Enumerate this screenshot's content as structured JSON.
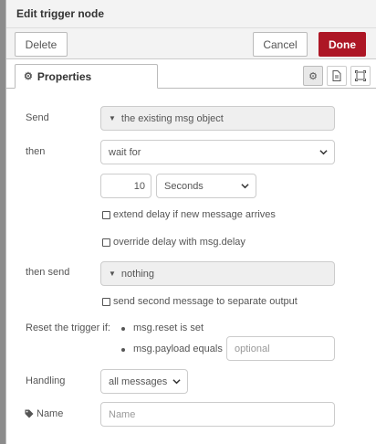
{
  "dialog": {
    "title": "Edit trigger node"
  },
  "tray": {
    "delete_label": "Delete",
    "cancel_label": "Cancel",
    "done_label": "Done"
  },
  "tabs": {
    "properties_label": "Properties"
  },
  "form": {
    "send": {
      "label": "Send",
      "value": "the existing msg object"
    },
    "then": {
      "label": "then",
      "value": "wait for"
    },
    "delay": {
      "value": "10",
      "unit": "Seconds"
    },
    "extend_delay": {
      "label": "extend delay if new message arrives",
      "checked": false
    },
    "override_delay": {
      "label": "override delay with msg.delay",
      "checked": false
    },
    "then_send": {
      "label": "then send",
      "value": "nothing"
    },
    "second_output": {
      "label": "send second message to separate output",
      "checked": false
    },
    "reset": {
      "label": "Reset the trigger if:",
      "option1": "msg.reset is set",
      "option2": "msg.payload equals",
      "payload_placeholder": "optional"
    },
    "handling": {
      "label": "Handling",
      "value": "all messages"
    },
    "name": {
      "label": "Name",
      "placeholder": "Name"
    }
  },
  "colors": {
    "primary": "#ad1625",
    "tray_background": "#f3f3f3",
    "readonly_background": "#efefef"
  },
  "icons": {
    "properties_tab": "gear-icon",
    "tab_buttons": [
      "gear-icon",
      "document-icon",
      "frame-icon"
    ],
    "name_label": "tag-icon",
    "dropdown": "chevron-down-icon",
    "readonly_select": "caret-down-icon"
  }
}
